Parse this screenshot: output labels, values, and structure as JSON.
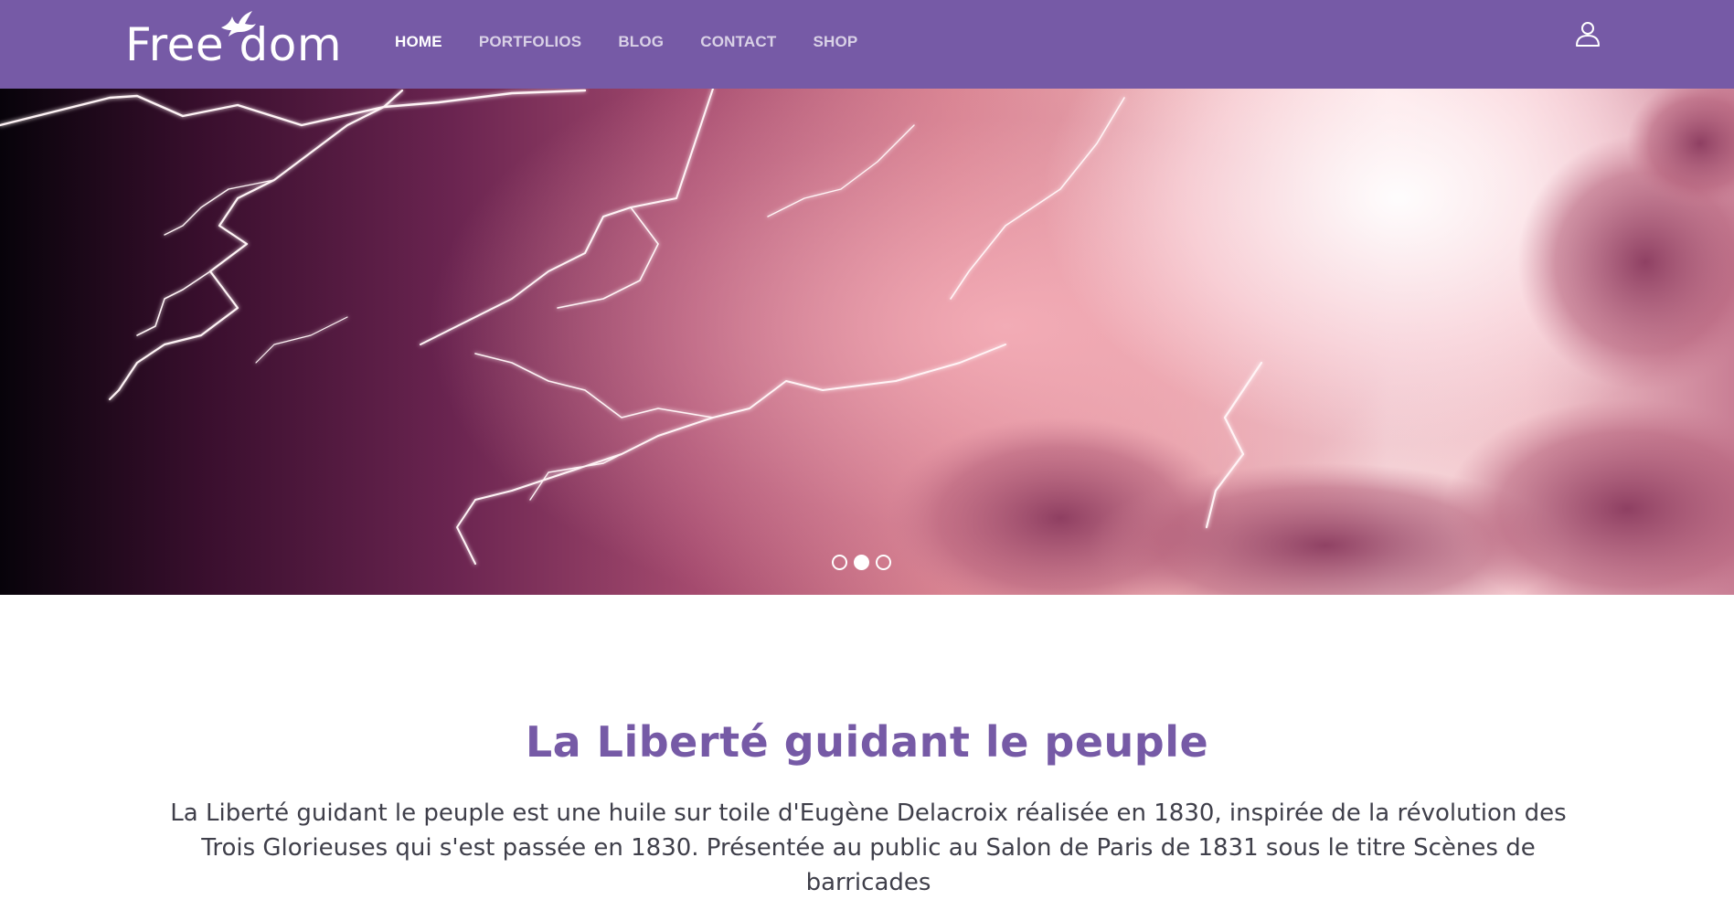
{
  "header": {
    "logo_text": "Free dom",
    "nav": [
      {
        "label": "HOME",
        "active": true
      },
      {
        "label": "PORTFOLIOS",
        "active": false
      },
      {
        "label": "BLOG",
        "active": false
      },
      {
        "label": "CONTACT",
        "active": false
      },
      {
        "label": "SHOP",
        "active": false
      }
    ],
    "user_icon": "user-icon",
    "logo_icon": "dove-icon"
  },
  "slider": {
    "image": "lightning-storm-sky",
    "slide_count": 3,
    "active_slide": 2
  },
  "content": {
    "title": "La Liberté guidant le peuple",
    "text": "La Liberté guidant le peuple est une huile sur toile d'Eugène Delacroix réalisée en 1830, inspirée de la révolution des Trois Glorieuses qui s'est passée en 1830. Présentée au public au Salon de Paris de 1831 sous le titre Scènes de barricades"
  },
  "colors": {
    "brand": "#765aa6",
    "nav_inactive": "rgba(255,255,255,0.72)",
    "text": "#3f3f4a"
  }
}
